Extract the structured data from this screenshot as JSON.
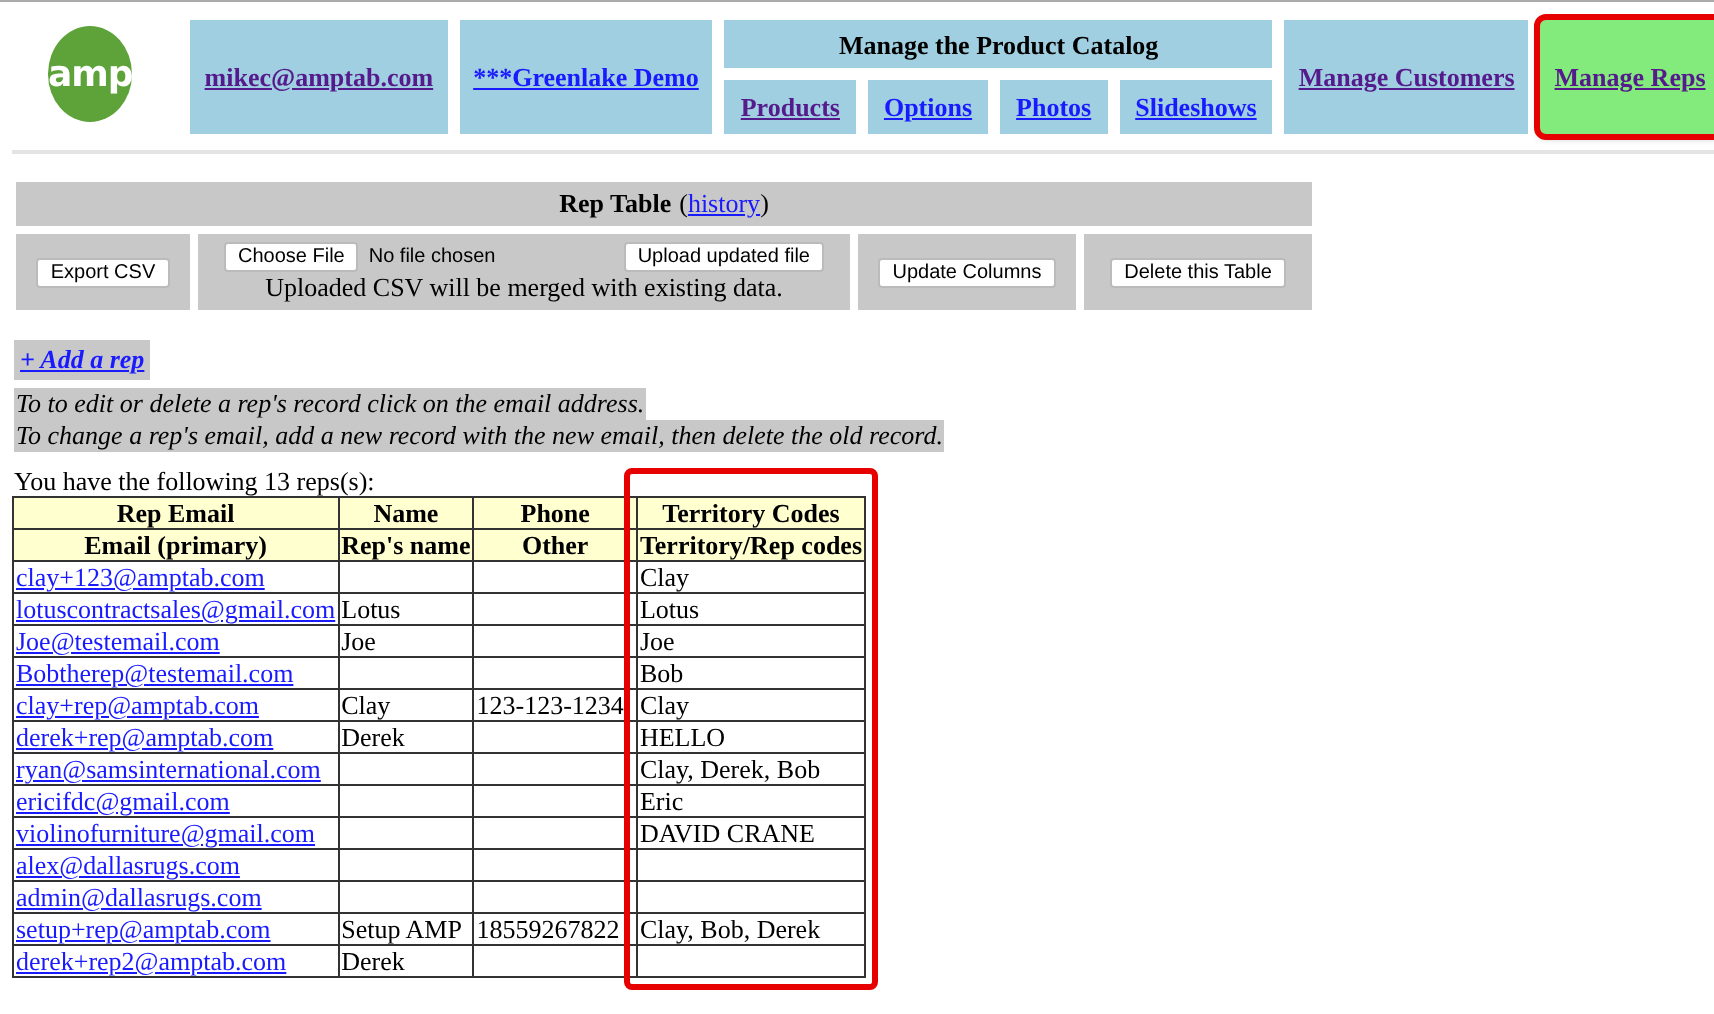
{
  "logo": {
    "text": "amp"
  },
  "nav": [
    {
      "kind": "link",
      "label": "mikec@amptab.com",
      "visited": true,
      "selected": false
    },
    {
      "kind": "link",
      "label": "***Greenlake Demo",
      "visited": false,
      "selected": false
    },
    {
      "kind": "group",
      "label": "Manage the Product Catalog",
      "children": [
        {
          "label": "Products",
          "visited": true
        },
        {
          "label": "Options",
          "visited": false
        },
        {
          "label": "Photos",
          "visited": false
        },
        {
          "label": "Slideshows",
          "visited": false
        }
      ]
    },
    {
      "kind": "link",
      "label": "Manage Customers",
      "visited": true,
      "selected": false
    },
    {
      "kind": "link",
      "label": "Manage Reps",
      "visited": true,
      "selected": true,
      "highlighted": true
    }
  ],
  "rep_table_panel": {
    "title": "Rep Table",
    "history_open": "(",
    "history_link": "history",
    "history_close": ")",
    "export_button": "Export CSV",
    "choose_file_button": "Choose File",
    "file_status": "No file chosen",
    "upload_button": "Upload updated file",
    "upload_note": "Uploaded CSV will be merged with existing data.",
    "update_columns_button": "Update Columns",
    "delete_button": "Delete this Table"
  },
  "add_link": "+ Add a rep",
  "instructions": [
    "To to edit or delete a rep's record click on the email address.",
    "To change a rep's email, add a new record with the new email, then delete the old record."
  ],
  "count_text": "You have the following 13 reps(s):",
  "table": {
    "columns": [
      {
        "label": "Rep Email",
        "sublabel": "Email (primary)"
      },
      {
        "label": "Name",
        "sublabel": "Rep's name"
      },
      {
        "label": "Phone",
        "sublabel": "Other"
      },
      {
        "label": "Territory Codes",
        "sublabel": "Territory/Rep codes",
        "highlighted": true
      }
    ],
    "rows": [
      {
        "email": "clay+123@amptab.com",
        "name": "",
        "phone": "",
        "territory": "Clay"
      },
      {
        "email": "lotuscontractsales@gmail.com",
        "name": "Lotus",
        "phone": "",
        "territory": "Lotus"
      },
      {
        "email": "Joe@testemail.com",
        "name": "Joe",
        "phone": "",
        "territory": "Joe"
      },
      {
        "email": "Bobtherep@testemail.com",
        "name": "",
        "phone": "",
        "territory": "Bob"
      },
      {
        "email": "clay+rep@amptab.com",
        "name": "Clay",
        "phone": "123-123-1234",
        "territory": "Clay"
      },
      {
        "email": "derek+rep@amptab.com",
        "name": "Derek",
        "phone": "",
        "territory": "HELLO"
      },
      {
        "email": "ryan@samsinternational.com",
        "name": "",
        "phone": "",
        "territory": "Clay, Derek, Bob"
      },
      {
        "email": "ericifdc@gmail.com",
        "name": "",
        "phone": "",
        "territory": "Eric"
      },
      {
        "email": "violinofurniture@gmail.com",
        "name": "",
        "phone": "",
        "territory": "DAVID CRANE"
      },
      {
        "email": "alex@dallasrugs.com",
        "name": "",
        "phone": "",
        "territory": ""
      },
      {
        "email": "admin@dallasrugs.com",
        "name": "",
        "phone": "",
        "territory": ""
      },
      {
        "email": "setup+rep@amptab.com",
        "name": "Setup AMP",
        "phone": "18559267822",
        "territory": "Clay, Bob, Derek"
      },
      {
        "email": "derek+rep2@amptab.com",
        "name": "Derek",
        "phone": "",
        "territory": ""
      }
    ]
  }
}
